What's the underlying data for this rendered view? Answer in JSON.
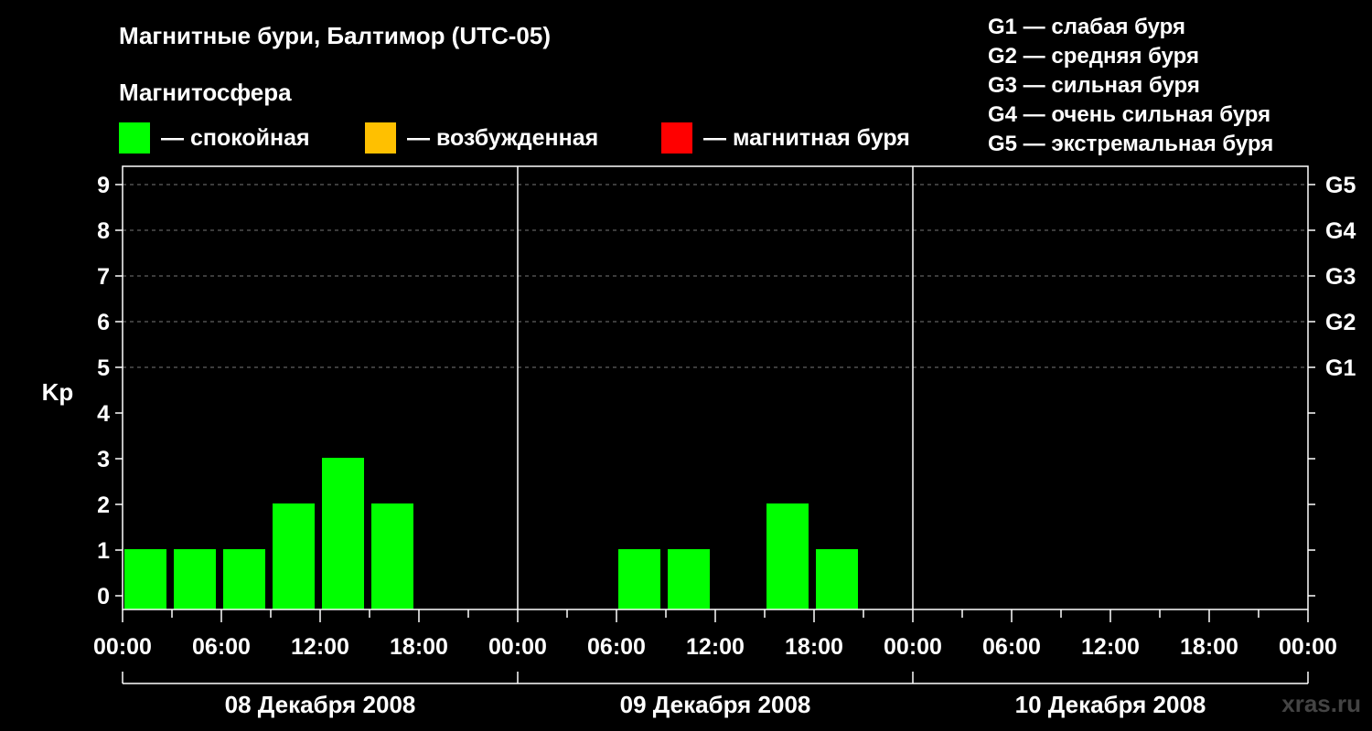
{
  "header": {
    "title": "Магнитные бури, Балтимор (UTC-05)",
    "subtitle": "Магнитосфера"
  },
  "legend": [
    {
      "label": "— спокойная",
      "color": "#00ff00"
    },
    {
      "label": "— возбужденная",
      "color": "#ffc000"
    },
    {
      "label": "— магнитная буря",
      "color": "#ff0000"
    }
  ],
  "storm_levels": [
    "G1 — слабая буря",
    "G2 — средняя буря",
    "G3 — сильная буря",
    "G4 — очень сильная буря",
    "G5 — экстремальная буря"
  ],
  "watermark": "xras.ru",
  "chart_data": {
    "type": "bar",
    "ylabel": "Kp",
    "ylim": [
      0,
      9
    ],
    "yticks": [
      "0",
      "1",
      "2",
      "3",
      "4",
      "5",
      "6",
      "7",
      "8",
      "9"
    ],
    "right_ticks": [
      {
        "kp": 5,
        "label": "G1"
      },
      {
        "kp": 6,
        "label": "G2"
      },
      {
        "kp": 7,
        "label": "G3"
      },
      {
        "kp": 8,
        "label": "G4"
      },
      {
        "kp": 9,
        "label": "G5"
      }
    ],
    "grid": true,
    "interval_hours": 3,
    "xtick_labels": [
      "00:00",
      "06:00",
      "12:00",
      "18:00",
      "00:00",
      "06:00",
      "12:00",
      "18:00",
      "00:00",
      "06:00",
      "12:00",
      "18:00",
      "00:00"
    ],
    "days": [
      "08 Декабря 2008",
      "09 Декабря 2008",
      "10 Декабря 2008"
    ],
    "series": [
      {
        "values": [
          1,
          1,
          1,
          2,
          3,
          2,
          null,
          null,
          null,
          null,
          1,
          1,
          null,
          2,
          1,
          null,
          null,
          null,
          null,
          null,
          null,
          null,
          null,
          null
        ],
        "color": "#00ff00"
      }
    ]
  }
}
